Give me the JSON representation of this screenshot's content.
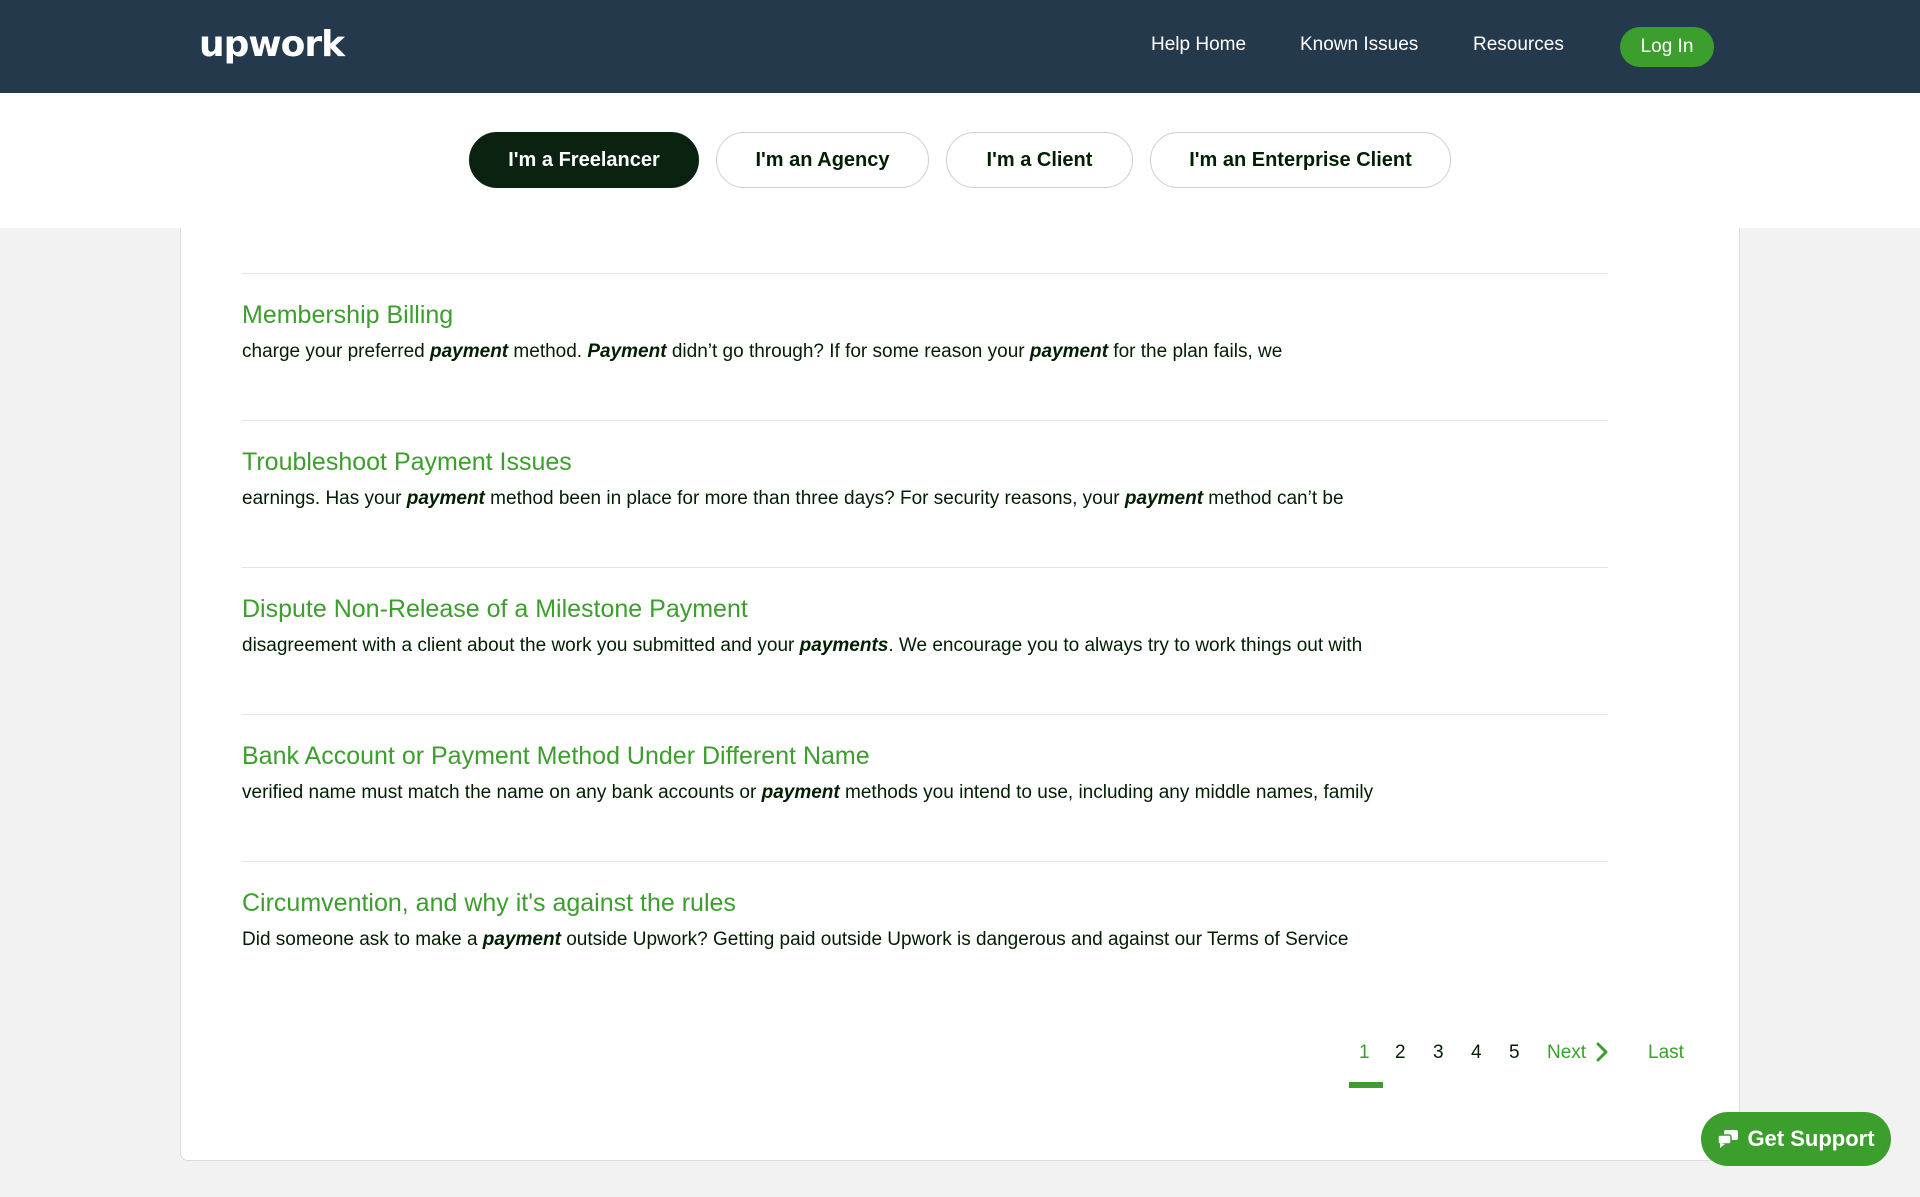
{
  "header": {
    "logo_text": "upwork",
    "nav": [
      "Help Home",
      "Known Issues",
      "Resources"
    ],
    "login_label": "Log In"
  },
  "tabs": [
    {
      "label": "I'm a Freelancer",
      "active": true
    },
    {
      "label": "I'm an Agency",
      "active": false
    },
    {
      "label": "I'm a Client",
      "active": false
    },
    {
      "label": "I'm an Enterprise Client",
      "active": false
    }
  ],
  "results": [
    {
      "title": "Membership Billing",
      "snippet_parts": [
        {
          "text": "charge your preferred ",
          "em": false
        },
        {
          "text": "payment",
          "em": true
        },
        {
          "text": " method. ",
          "em": false
        },
        {
          "text": "Payment",
          "em": true
        },
        {
          "text": " didn’t go through? If for some reason your ",
          "em": false
        },
        {
          "text": "payment",
          "em": true
        },
        {
          "text": " for the plan fails, we",
          "em": false
        }
      ]
    },
    {
      "title": "Troubleshoot Payment Issues",
      "snippet_parts": [
        {
          "text": "earnings. Has your ",
          "em": false
        },
        {
          "text": "payment",
          "em": true
        },
        {
          "text": " method been in place for more than three days? For security reasons, your ",
          "em": false
        },
        {
          "text": "payment",
          "em": true
        },
        {
          "text": " method can’t be",
          "em": false
        }
      ]
    },
    {
      "title": "Dispute Non-Release of a Milestone Payment",
      "snippet_parts": [
        {
          "text": "disagreement with a client about the work you submitted and your ",
          "em": false
        },
        {
          "text": "payments",
          "em": true
        },
        {
          "text": ". We encourage you to always try to work things out with",
          "em": false
        }
      ]
    },
    {
      "title": "Bank Account or Payment Method Under Different Name",
      "snippet_parts": [
        {
          "text": "verified name must match the name on any bank accounts or ",
          "em": false
        },
        {
          "text": "payment",
          "em": true
        },
        {
          "text": " methods you intend to use, including any middle names, family",
          "em": false
        }
      ]
    },
    {
      "title": "Circumvention, and why it's against the rules",
      "snippet_parts": [
        {
          "text": "Did someone ask to make a ",
          "em": false
        },
        {
          "text": "payment",
          "em": true
        },
        {
          "text": " outside Upwork? Getting paid outside Upwork is dangerous and against our Terms of Service",
          "em": false
        }
      ]
    }
  ],
  "pagination": {
    "pages": [
      "1",
      "2",
      "3",
      "4",
      "5"
    ],
    "current": "1",
    "next_label": "Next",
    "last_label": "Last"
  },
  "support_button": {
    "label": "Get Support",
    "icon": "chat-bubbles-icon"
  },
  "colors": {
    "header_bg": "#25394c",
    "brand_green": "#3c9e2c",
    "active_tab_bg": "#0b2211",
    "page_bg": "#f2f2f2"
  }
}
